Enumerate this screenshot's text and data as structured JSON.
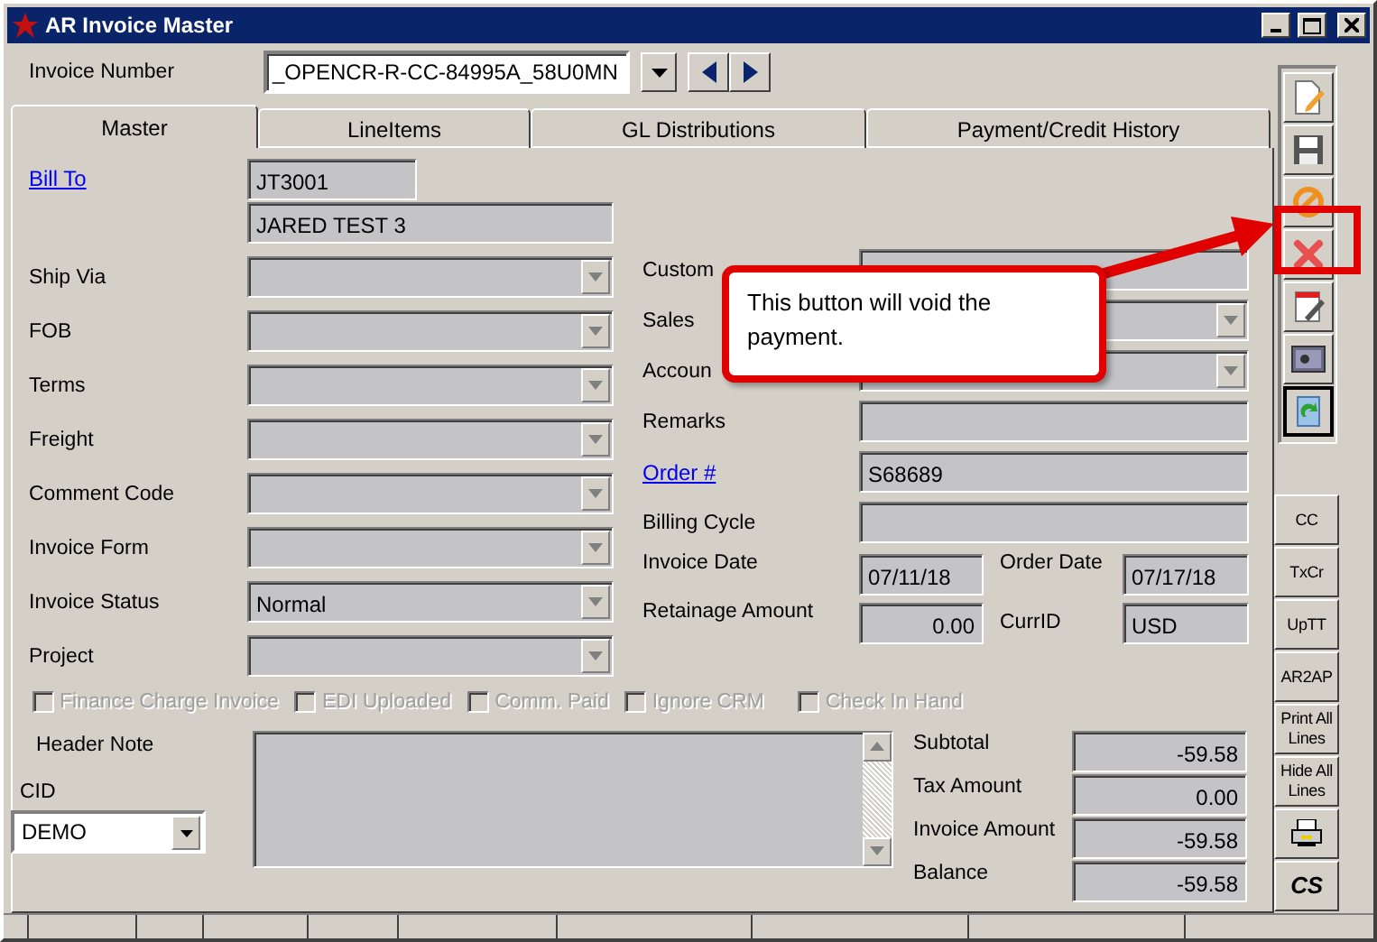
{
  "window": {
    "title": "AR Invoice Master"
  },
  "invoice_number": {
    "label": "Invoice Number",
    "value": "_OPENCR-R-CC-84995A_58U0MN"
  },
  "tabs": [
    {
      "label": "Master",
      "selected": true
    },
    {
      "label": "LineItems",
      "selected": false
    },
    {
      "label": "GL Distributions",
      "selected": false
    },
    {
      "label": "Payment/Credit History",
      "selected": false
    }
  ],
  "bill_to": {
    "label": "Bill To",
    "code": "JT3001",
    "name": "JARED TEST 3"
  },
  "left_fields": [
    {
      "label": "Ship Via",
      "kind": "combo"
    },
    {
      "label": "FOB",
      "kind": "combo"
    },
    {
      "label": "Terms",
      "kind": "combo"
    },
    {
      "label": "Freight",
      "kind": "combo"
    },
    {
      "label": "Comment Code",
      "kind": "combo"
    },
    {
      "label": "Invoice Form",
      "kind": "combo"
    },
    {
      "label": "Invoice Status",
      "kind": "combo",
      "value": "Normal"
    },
    {
      "label": "Project",
      "kind": "combo"
    }
  ],
  "right_fields": [
    {
      "label": "Custom",
      "kind": "text"
    },
    {
      "label": "Sales",
      "kind": "combo"
    },
    {
      "label": "Accoun",
      "kind": "combo"
    },
    {
      "label": "Remarks",
      "kind": "text"
    },
    {
      "label": "Order #",
      "kind": "link",
      "value": "S68689"
    },
    {
      "label": "Billing Cycle",
      "kind": "text"
    }
  ],
  "pairs": [
    {
      "label": "Invoice Date",
      "value": "07/11/18",
      "label_2": "Order Date",
      "value_2": "07/17/18"
    },
    {
      "label": "Retainage Amount",
      "value": "0.00",
      "label_2": "CurrID",
      "value_2": "USD"
    }
  ],
  "checkboxes": [
    {
      "label": "Finance Charge Invoice",
      "checked": false,
      "disabled": true
    },
    {
      "label": "EDI Uploaded",
      "checked": false,
      "disabled": true
    },
    {
      "label": "Comm. Paid",
      "checked": false,
      "disabled": true
    },
    {
      "label": "Ignore CRM",
      "checked": false,
      "disabled": true
    },
    {
      "label": "Check In Hand",
      "checked": false,
      "disabled": true
    }
  ],
  "header_note": {
    "label": "Header Note"
  },
  "cid": {
    "label": "CID",
    "value": "DEMO"
  },
  "totals": [
    {
      "label": "Subtotal",
      "value": "-59.58"
    },
    {
      "label": "Tax Amount",
      "value": "0.00"
    },
    {
      "label": "Invoice Amount",
      "value": "-59.58"
    },
    {
      "label": "Balance",
      "value": "-59.58"
    }
  ],
  "toolbar": [
    {
      "kind": "new"
    },
    {
      "kind": "save"
    },
    {
      "kind": "cancel"
    },
    {
      "kind": "delete"
    },
    {
      "kind": "edit"
    },
    {
      "kind": "safe"
    },
    {
      "kind": "refresh"
    }
  ],
  "side_buttons": [
    {
      "kind": "text",
      "label": "CC"
    },
    {
      "kind": "text",
      "label": "TxCr"
    },
    {
      "kind": "text",
      "label": "UpTT"
    },
    {
      "kind": "text",
      "label": "AR2AP"
    },
    {
      "kind": "text",
      "label": "Print All Lines"
    },
    {
      "kind": "text",
      "label": "Hide All Lines"
    },
    {
      "kind": "print"
    },
    {
      "kind": "bold",
      "label": "CS"
    }
  ],
  "callout": {
    "text": "This button will void the payment."
  }
}
